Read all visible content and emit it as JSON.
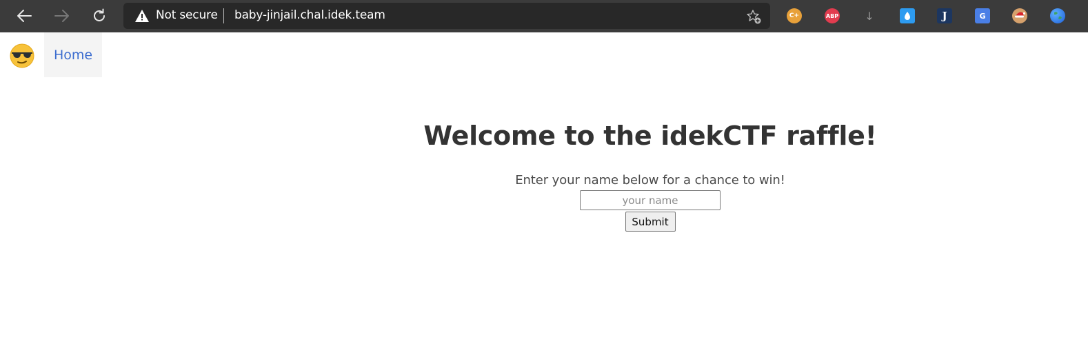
{
  "browser": {
    "security_label": "Not secure",
    "url": "baby-jinjail.chal.idek.team",
    "extensions": [
      {
        "name": "cplusplus",
        "glyph": "C+",
        "color": "#e8a13a"
      },
      {
        "name": "adblock-plus",
        "glyph": "ABP",
        "color": "#e23c4f"
      },
      {
        "name": "downloads",
        "glyph": "↓",
        "color": "#9a9a9a"
      },
      {
        "name": "droplet",
        "glyph": "💧",
        "color": "#2d9bf0"
      },
      {
        "name": "j-extension",
        "glyph": "J",
        "color": "#1c3660"
      },
      {
        "name": "google-translate",
        "glyph": "G",
        "color": "#4a7fe6"
      },
      {
        "name": "santa",
        "glyph": "🎅",
        "color": "#d6a16c"
      },
      {
        "name": "globe",
        "glyph": "",
        "color": "#1e5fd8"
      }
    ]
  },
  "nav": {
    "logo_icon": "sunglasses-face-emoji",
    "home_label": "Home"
  },
  "main": {
    "title": "Welcome to the idekCTF raffle!",
    "prompt": "Enter your name below for a chance to win!",
    "input_placeholder": "your name",
    "input_value": "",
    "submit_label": "Submit"
  }
}
